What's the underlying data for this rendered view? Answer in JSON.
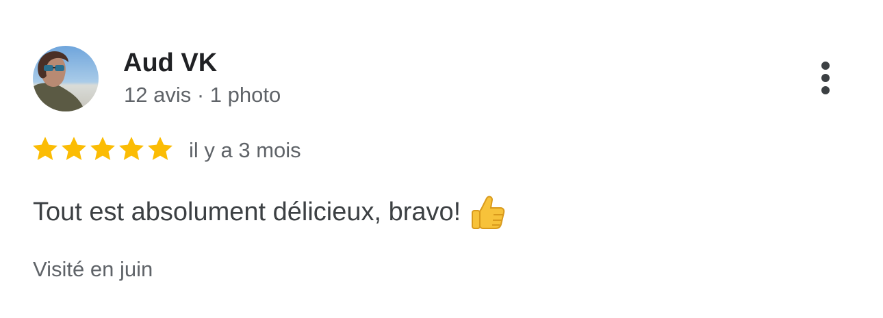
{
  "author": {
    "name": "Aud VK",
    "meta": "12 avis · 1 photo"
  },
  "review": {
    "rating": 5,
    "max_rating": 5,
    "date": "il y a 3 mois",
    "text": "Tout est absolument délicieux, bravo!",
    "emoji": "thumbs-up-icon",
    "visit": "Visité en juin"
  },
  "icons": {
    "more": "more-vert-icon",
    "star": "star-icon"
  },
  "colors": {
    "star": "#FBBC04",
    "name": "#202124",
    "secondary_text": "#5f6368",
    "body_text": "#3c4043"
  }
}
